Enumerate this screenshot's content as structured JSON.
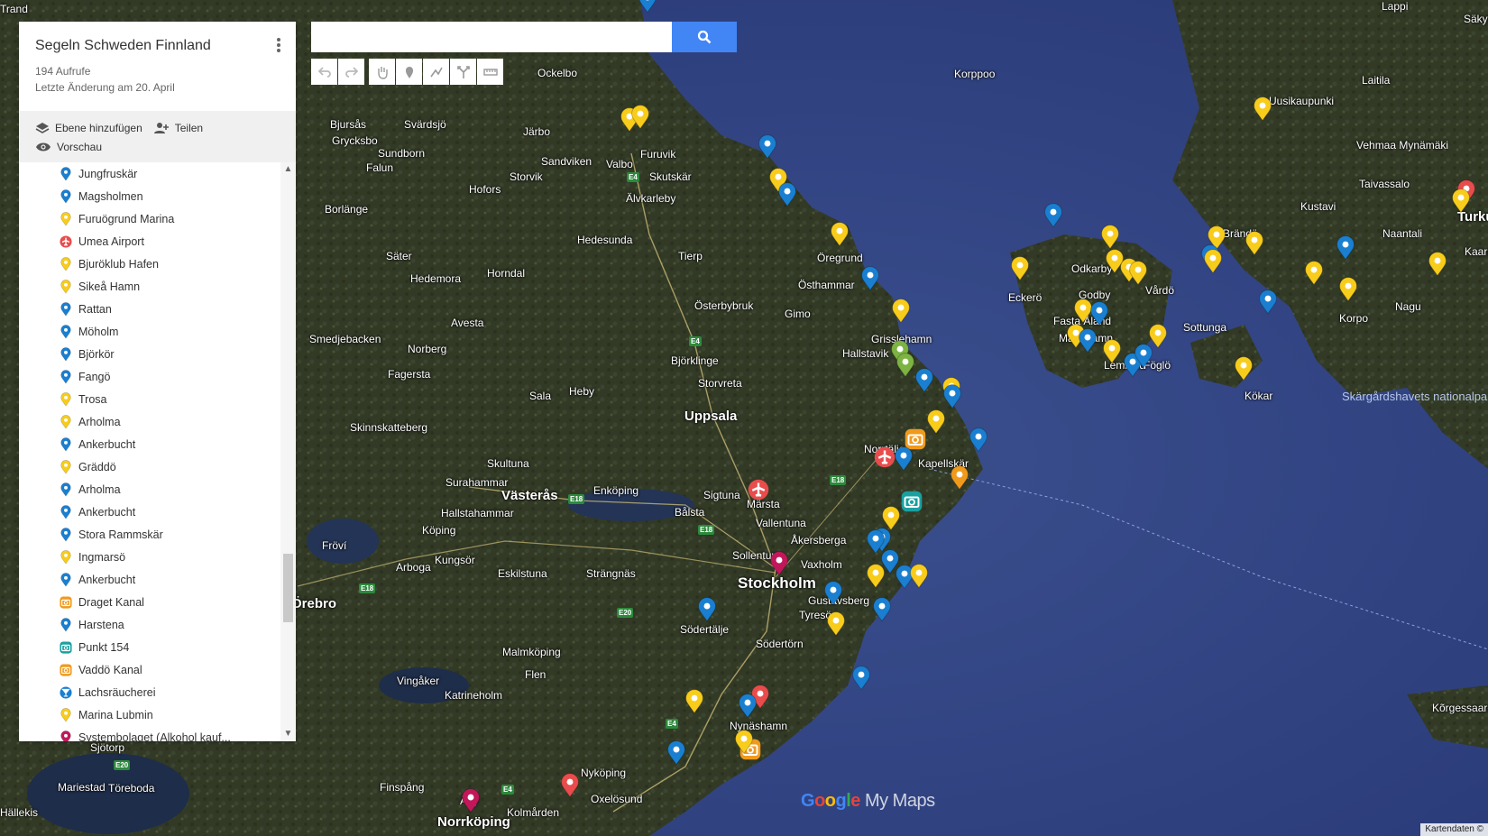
{
  "map": {
    "title": "Segeln Schweden Finnland",
    "views": "194 Aufrufe",
    "last_changed": "Letzte Änderung am 20. April",
    "actions": {
      "add_layer": "Ebene hinzufügen",
      "share": "Teilen",
      "preview": "Vorschau"
    },
    "items": [
      {
        "label": "Jungfruskär",
        "icon": "pin-blue"
      },
      {
        "label": "Magsholmen",
        "icon": "pin-blue"
      },
      {
        "label": "Furuögrund Marina",
        "icon": "pin-yellow"
      },
      {
        "label": "Umea Airport",
        "icon": "airport-red"
      },
      {
        "label": "Bjuröklub Hafen",
        "icon": "pin-yellow"
      },
      {
        "label": "Sikeå Hamn",
        "icon": "pin-yellow"
      },
      {
        "label": "Rattan",
        "icon": "pin-blue"
      },
      {
        "label": "Möholm",
        "icon": "pin-blue"
      },
      {
        "label": "Björkör",
        "icon": "pin-blue"
      },
      {
        "label": "Fangö",
        "icon": "pin-blue"
      },
      {
        "label": "Trosa",
        "icon": "pin-yellow"
      },
      {
        "label": "Arholma",
        "icon": "pin-yellow"
      },
      {
        "label": "Ankerbucht",
        "icon": "pin-blue"
      },
      {
        "label": "Gräddö",
        "icon": "pin-yellow"
      },
      {
        "label": "Arholma",
        "icon": "pin-blue"
      },
      {
        "label": "Ankerbucht",
        "icon": "pin-blue"
      },
      {
        "label": "Stora Rammskär",
        "icon": "pin-blue"
      },
      {
        "label": "Ingmarsö",
        "icon": "pin-yellow"
      },
      {
        "label": "Ankerbucht",
        "icon": "pin-blue"
      },
      {
        "label": "Draget Kanal",
        "icon": "camera-orange"
      },
      {
        "label": "Harstena",
        "icon": "pin-blue"
      },
      {
        "label": "Punkt 154",
        "icon": "camera-teal"
      },
      {
        "label": "Vaddö Kanal",
        "icon": "camera-orange"
      },
      {
        "label": "Lachsräucherei",
        "icon": "bar-blue"
      },
      {
        "label": "Marina Lubmin",
        "icon": "pin-yellow"
      },
      {
        "label": "Systembolaget (Alkohol kauf...",
        "icon": "pin-magenta"
      }
    ]
  },
  "search": {
    "placeholder": ""
  },
  "toolbar": [
    "undo-icon",
    "redo-icon",
    "hand-icon",
    "marker-icon",
    "line-icon",
    "directions-icon",
    "ruler-icon"
  ],
  "colors": {
    "blue": "#1a7fd0",
    "yellow": "#f8cc1b",
    "red": "#e84c4c",
    "orange": "#f09a1c",
    "green": "#7cb342",
    "teal": "#1aa0a0",
    "magenta": "#c2185b"
  },
  "places": [
    "Trand",
    "Ockelbo",
    "Bjursås",
    "Svärdsjö",
    "Järbo",
    "Grycksbo",
    "Sandviken",
    "Valbo",
    "Furuvik",
    "Falun",
    "Sundborn",
    "Storvik",
    "Hofors",
    "Skutskär",
    "Älvkarleby",
    "Borlänge",
    "Hedesunda",
    "Säter",
    "Hedemora",
    "Horndal",
    "Tierp",
    "Öregrund",
    "Östhammar",
    "Gimo",
    "Österbybruk",
    "Avesta",
    "Smedjebacken",
    "Norberg",
    "Fagersta",
    "Björklinge",
    "Hallstavik",
    "Grisslehamn",
    "Storvreta",
    "Heby",
    "Sala",
    "Uppsala",
    "Skinnskatteberg",
    "Norrtälje",
    "Kapellskär",
    "Skultuna",
    "Surahammar",
    "Västerås",
    "Enköping",
    "Sigtuna",
    "Märsta",
    "Hallstahammar",
    "Bålsta",
    "Vallentuna",
    "Köping",
    "Åkersberga",
    "Fröví",
    "Kungsör",
    "Eskilstuna",
    "Strängnäs",
    "Sollentuna",
    "Vaxholm",
    "Arboga",
    "Stockholm",
    "Gustavsberg",
    "Tyresö",
    "Södertälje",
    "Södertörn",
    "Örebro",
    "Malmköping",
    "Vingåker",
    "Flen",
    "Katrineholm",
    "Nynäshamn",
    "Nyköping",
    "Oxelösund",
    "Finspång",
    "Åby",
    "Kolmården",
    "Norrköping",
    "Mariestad",
    "Töreboda",
    "Sjötorp",
    "Hällekis",
    "Lappi",
    "Säkylä",
    "Laitila",
    "Uusikaupunki",
    "Vehmaa Mynämäki",
    "Taivassalo",
    "Kustavi",
    "Turku",
    "Naantali",
    "Brändö",
    "Kaarina",
    "Odkarby",
    "Godby",
    "Vårdö",
    "Eckerö",
    "Fasta Åland",
    "Mariehamn",
    "Lemland",
    "Föglö",
    "Sottunga",
    "Kökar",
    "Korpo",
    "Nagu",
    "Skärgårdshavets nationalpark",
    "Korppoo",
    "Kõrgessaare"
  ],
  "roads": [
    "E4",
    "E4",
    "E18",
    "E18",
    "E18",
    "E18",
    "E20",
    "E4",
    "E4",
    "E20"
  ],
  "branding": {
    "logo": "Google My Maps",
    "attribution": "Kartendaten ©"
  }
}
